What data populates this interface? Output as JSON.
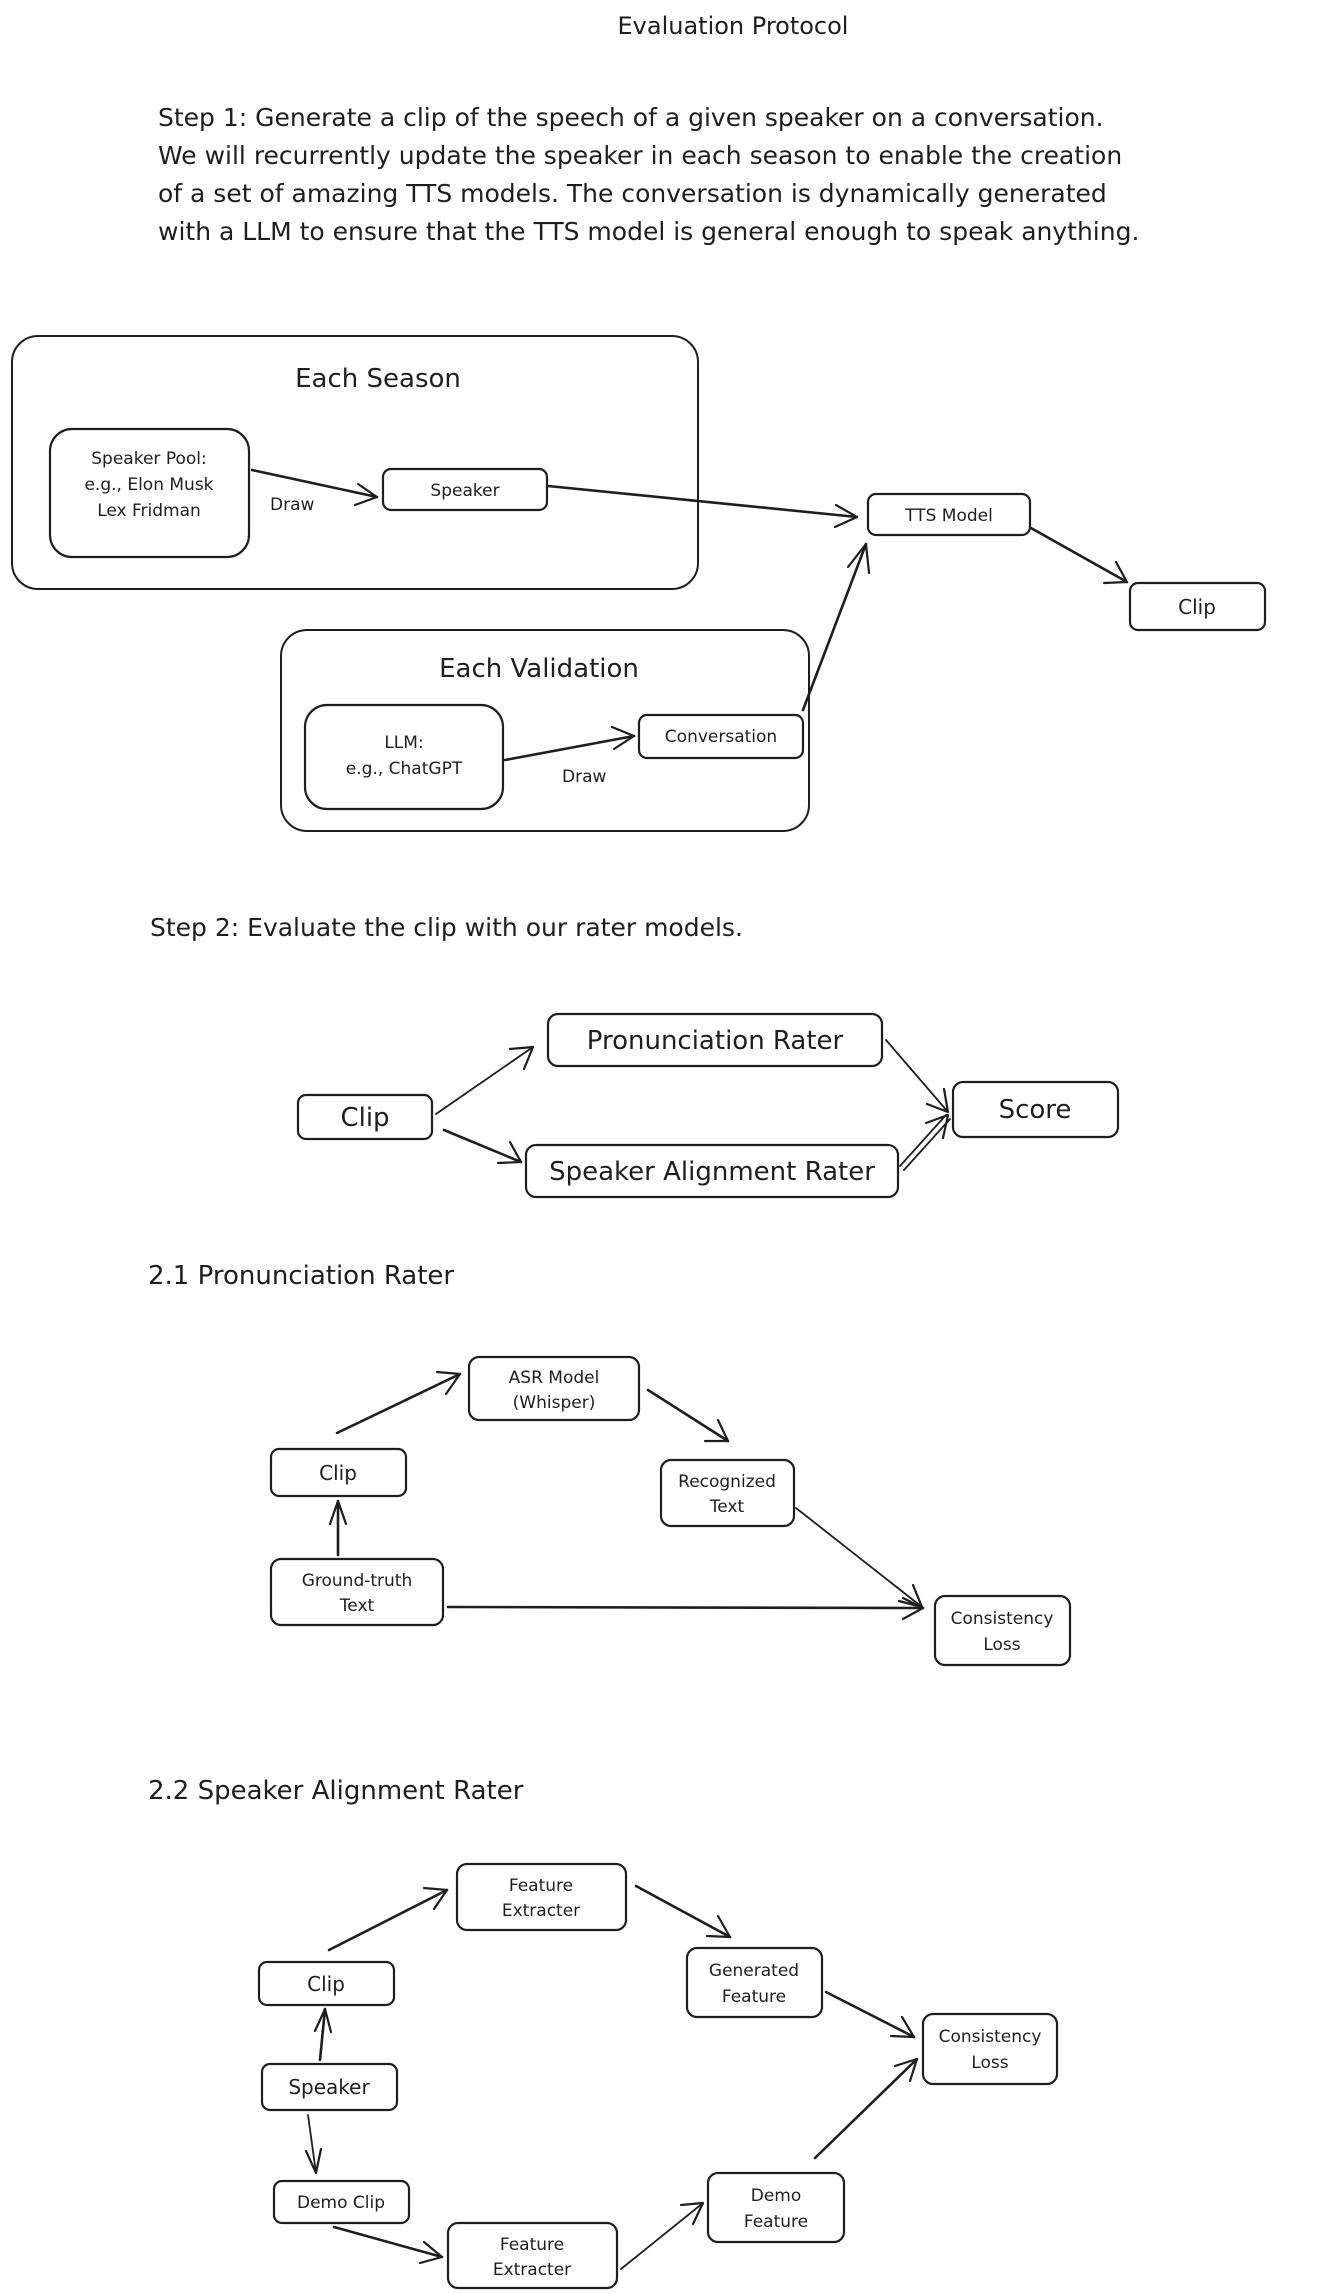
{
  "title": "Evaluation Protocol",
  "step1": {
    "lines": [
      "Step 1: Generate a clip of the speech of a given speaker on a conversation.",
      "We will recurrently update the speaker in each season to enable the creation",
      "of a set of amazing TTS models. The conversation is dynamically generated",
      "with a LLM to ensure that the TTS model is general enough to speak anything."
    ],
    "groups": {
      "season": "Each Season",
      "validation": "Each Validation"
    },
    "nodes": {
      "speaker_pool": [
        "Speaker Pool:",
        "e.g., Elon Musk",
        "Lex Fridman"
      ],
      "speaker": [
        "Speaker"
      ],
      "tts_model": [
        "TTS Model"
      ],
      "clip": [
        "Clip"
      ],
      "llm": [
        "LLM:",
        "e.g., ChatGPT"
      ],
      "conversation": [
        "Conversation"
      ]
    },
    "edge_labels": {
      "pool_to_speaker": "Draw",
      "llm_to_conversation": "Draw"
    }
  },
  "step2": {
    "text": "Step 2: Evaluate the clip with our rater models.",
    "nodes": {
      "clip": [
        "Clip"
      ],
      "pronunciation_rater": [
        "Pronunciation Rater"
      ],
      "speaker_alignment_rater": [
        "Speaker Alignment Rater"
      ],
      "score": [
        "Score"
      ]
    }
  },
  "pronunciation": {
    "heading": "2.1 Pronunciation Rater",
    "nodes": {
      "asr_model": [
        "ASR Model",
        "(Whisper)"
      ],
      "clip": [
        "Clip"
      ],
      "recognized_text": [
        "Recognized",
        "Text"
      ],
      "ground_truth": [
        "Ground-truth",
        "Text"
      ],
      "consistency_loss": [
        "Consistency",
        "Loss"
      ]
    }
  },
  "alignment": {
    "heading": "2.2 Speaker Alignment Rater",
    "nodes": {
      "feature_extracter_top": [
        "Feature",
        "Extracter"
      ],
      "clip": [
        "Clip"
      ],
      "generated_feature": [
        "Generated",
        "Feature"
      ],
      "consistency_loss": [
        "Consistency",
        "Loss"
      ],
      "speaker": [
        "Speaker"
      ],
      "demo_clip": [
        "Demo Clip"
      ],
      "feature_extracter_bottom": [
        "Feature",
        "Extracter"
      ],
      "demo_feature": [
        "Demo",
        "Feature"
      ]
    }
  }
}
